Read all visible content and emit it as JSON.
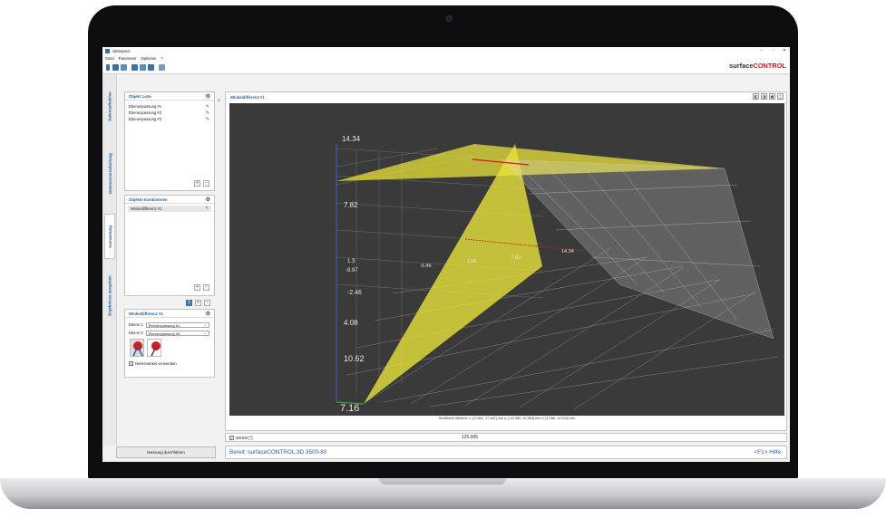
{
  "app": {
    "title": "3Dinspect"
  },
  "menu": [
    "Datei",
    "Parameter",
    "Optionen",
    "?"
  ],
  "brand": {
    "prefix": "surface",
    "suffix": "CONTROL"
  },
  "sidebar_tabs": [
    "Datenaufnahme",
    "Datenvorverarbeitung",
    "Auswertung",
    "Ergebnisse ausgeben"
  ],
  "objects_panel": {
    "title": "Objekt Liste",
    "items": [
      "Ebenenpassung #1",
      "Ebenenpassung #2",
      "Ebenenpassung #3"
    ]
  },
  "combine_panel": {
    "title": "Objekte kombinieren",
    "items": [
      "Winkeldifferenz #1"
    ]
  },
  "detail_panel": {
    "title": "Winkeldifferenz #1",
    "plane1_label": "Ebene 1:",
    "plane1_value": "Ebenenpassung #1",
    "plane2_label": "Ebene 2:",
    "plane2_value": "Ebenenpassung #3",
    "checkbox_label": "Nebenwinkel verwenden"
  },
  "measure_button": "Messung durchführen",
  "main_panel": {
    "title": "Winkeldifferenz #1"
  },
  "axis_labels": {
    "z_top": "14.34",
    "z_mid": "7.82",
    "y_1": "1.3",
    "y_2": "-9.97",
    "y_3": "-2.46",
    "y_4": "4.08",
    "y_5": "10.62",
    "y_6": "7.16",
    "x_1": "-5.46",
    "x_2": "1.06",
    "x_3": "7.82",
    "x_4": "14.34"
  },
  "visible_area_text": "Sichtbarer Bereich:  x: [-9.691, 27.487] mm   y: [-13.280, 16.963] mm   z: [1.286, 14.534] mm",
  "angle": {
    "label": "Winkel [°]",
    "value": "125.005"
  },
  "status": {
    "text": "Bereit: surfaceCONTROL 3D 3500-80",
    "help": "<F1> Hilfe"
  },
  "colors": {
    "accent": "#2a5ea8",
    "brand_red": "#d71920",
    "plane": "#e8e23a",
    "viewport_bg": "#3a3a3a"
  }
}
